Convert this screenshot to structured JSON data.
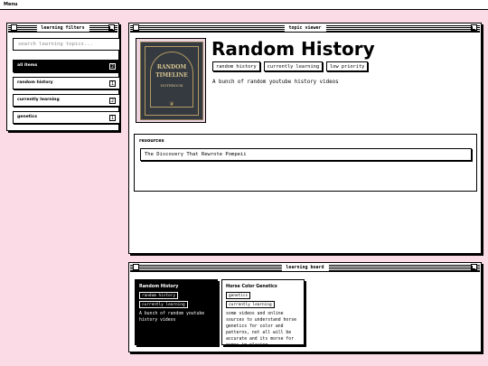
{
  "menubar": {
    "label": "Menu"
  },
  "filters_window": {
    "title": "learning filters",
    "search_placeholder": "search learning topics...",
    "items": [
      {
        "label": "all items",
        "count": "2",
        "active": true
      },
      {
        "label": "random history",
        "count": "1",
        "active": false
      },
      {
        "label": "currently learning",
        "count": "2",
        "active": false
      },
      {
        "label": "genetics",
        "count": "1",
        "active": false
      }
    ]
  },
  "topic_window": {
    "title": "topic viewer",
    "cover": {
      "line1": "RANDOM",
      "line2": "TIMELINE",
      "line3": "NOTEBOOK",
      "ornament": "❦"
    },
    "topic_title": "Random History",
    "tags": [
      "random history",
      "currently learning",
      "low priority"
    ],
    "description": "A bunch of random youtube history videos",
    "resources": {
      "heading": "resources",
      "items": [
        "The Discovery That Rewrote Pompeii"
      ]
    }
  },
  "board_window": {
    "title": "learning board",
    "cards": [
      {
        "title": "Random History",
        "tags": [
          "random history",
          "currently learning"
        ],
        "description": "A bunch of random youtube history videos",
        "selected": true
      },
      {
        "title": "Horse Color Genetics",
        "tags": [
          "genetics",
          "currently learning"
        ],
        "description": "some videos and online sources to understand horse genetics for color and patterns, not all will be accurate and its morse for games im playing",
        "selected": false
      }
    ]
  },
  "colors": {
    "background": "#fbdce6",
    "accent": "#000000",
    "surface": "#ffffff"
  }
}
